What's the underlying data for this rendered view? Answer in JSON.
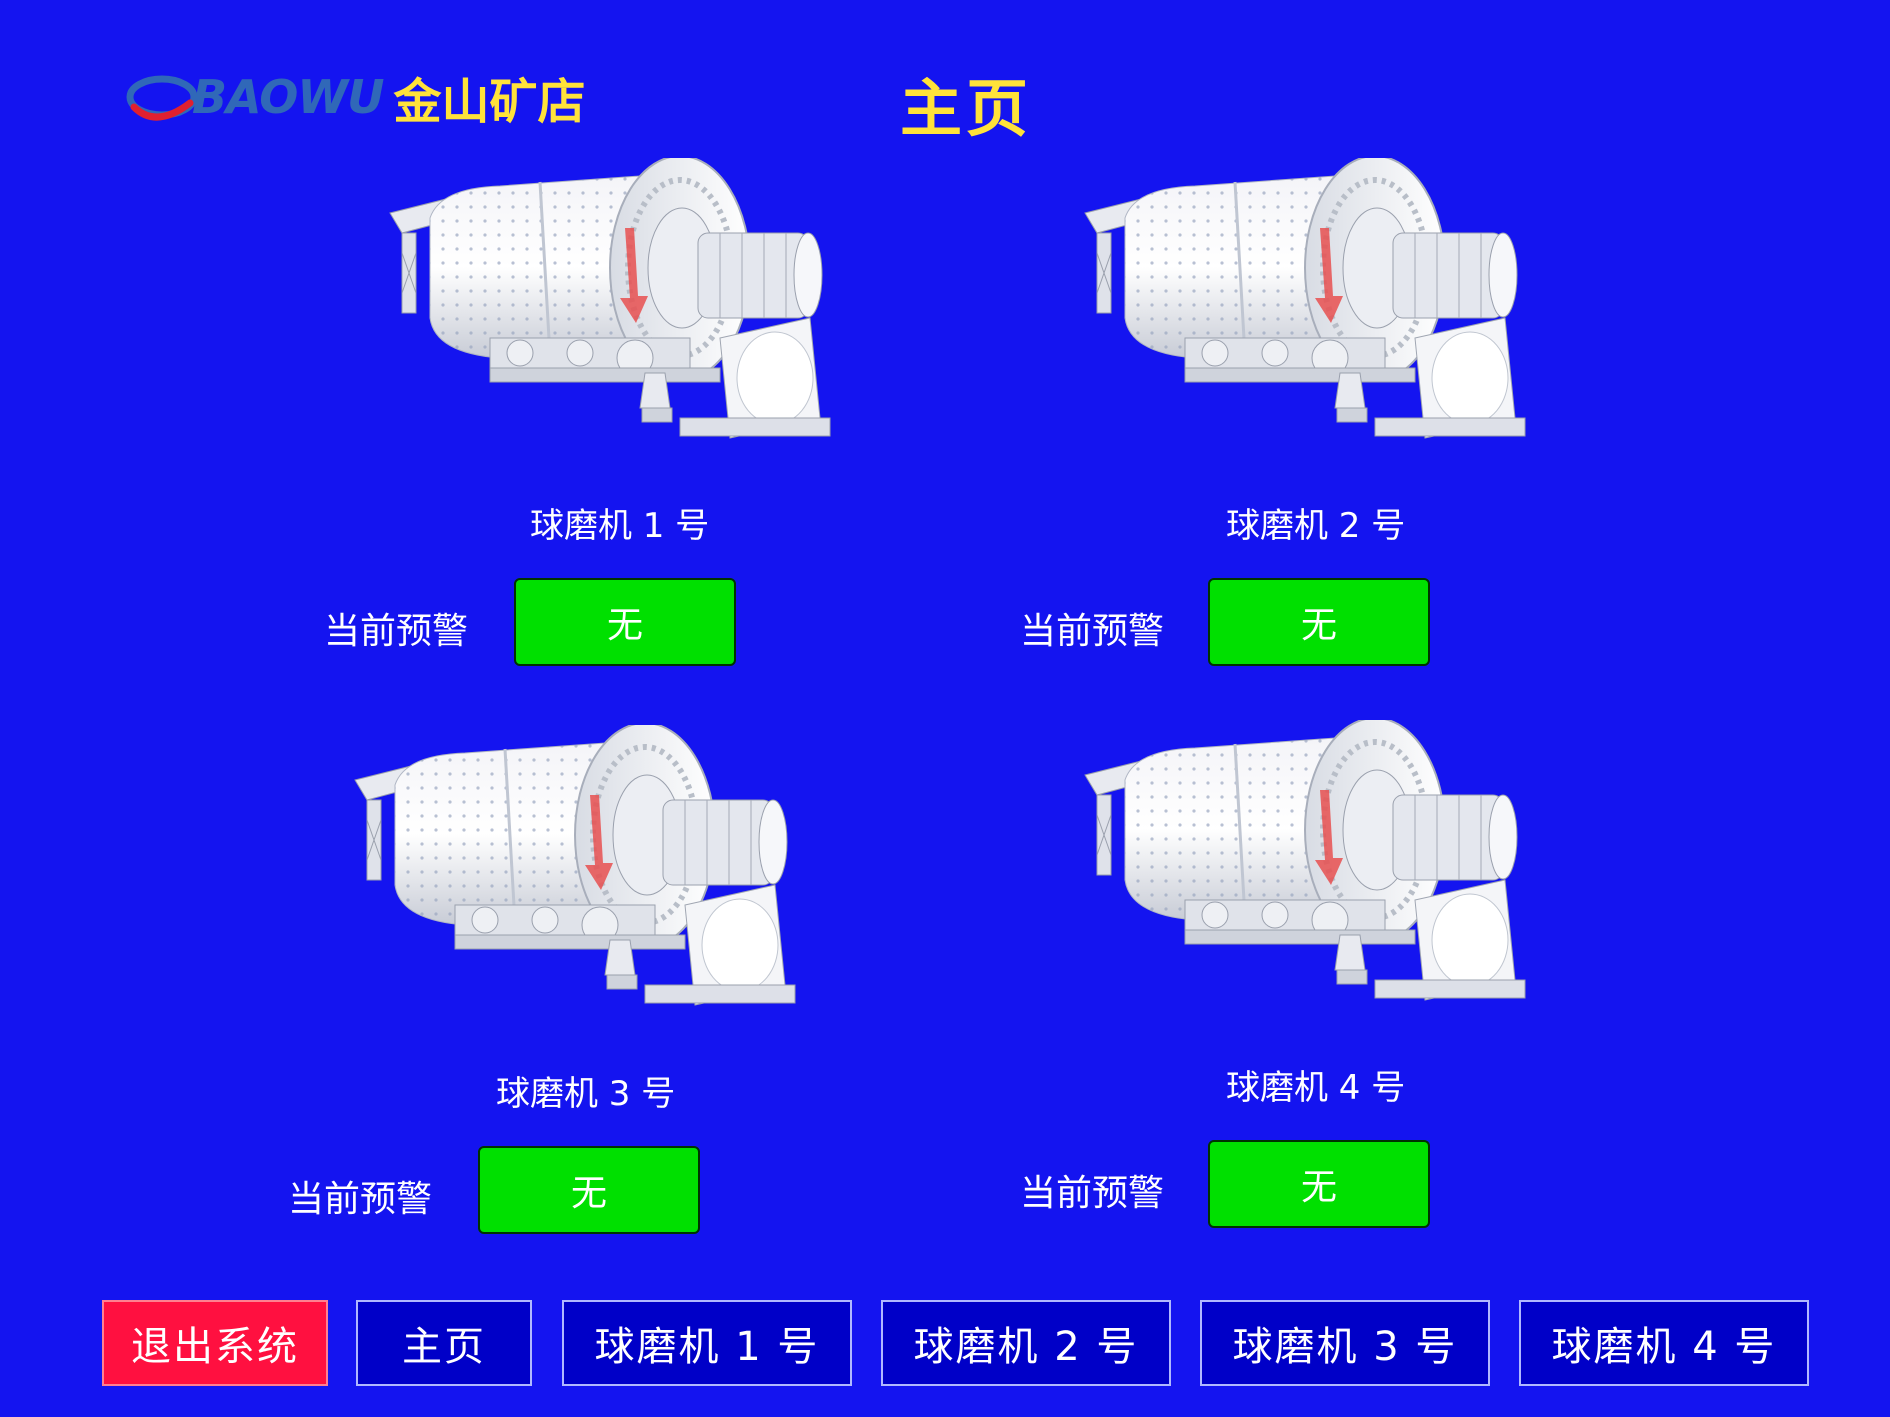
{
  "header": {
    "logo_text": "BAOWU",
    "logo_company": "金山矿店",
    "page_title": "主页"
  },
  "mills": [
    {
      "label": "球磨机 1 号",
      "warning_label": "当前预警",
      "warning_value": "无"
    },
    {
      "label": "球磨机 2 号",
      "warning_label": "当前预警",
      "warning_value": "无"
    },
    {
      "label": "球磨机 3 号",
      "warning_label": "当前预警",
      "warning_value": "无"
    },
    {
      "label": "球磨机 4 号",
      "warning_label": "当前预警",
      "warning_value": "无"
    }
  ],
  "nav": {
    "exit": "退出系统",
    "home": "主页",
    "mill1": "球磨机 1 号",
    "mill2": "球磨机 2 号",
    "mill3": "球磨机 3 号",
    "mill4": "球磨机 4 号"
  },
  "colors": {
    "background": "#1414f0",
    "title": "#ffe23a",
    "warning_ok": "#00e000",
    "exit_button": "#ff1040",
    "nav_button": "#0000c8"
  }
}
